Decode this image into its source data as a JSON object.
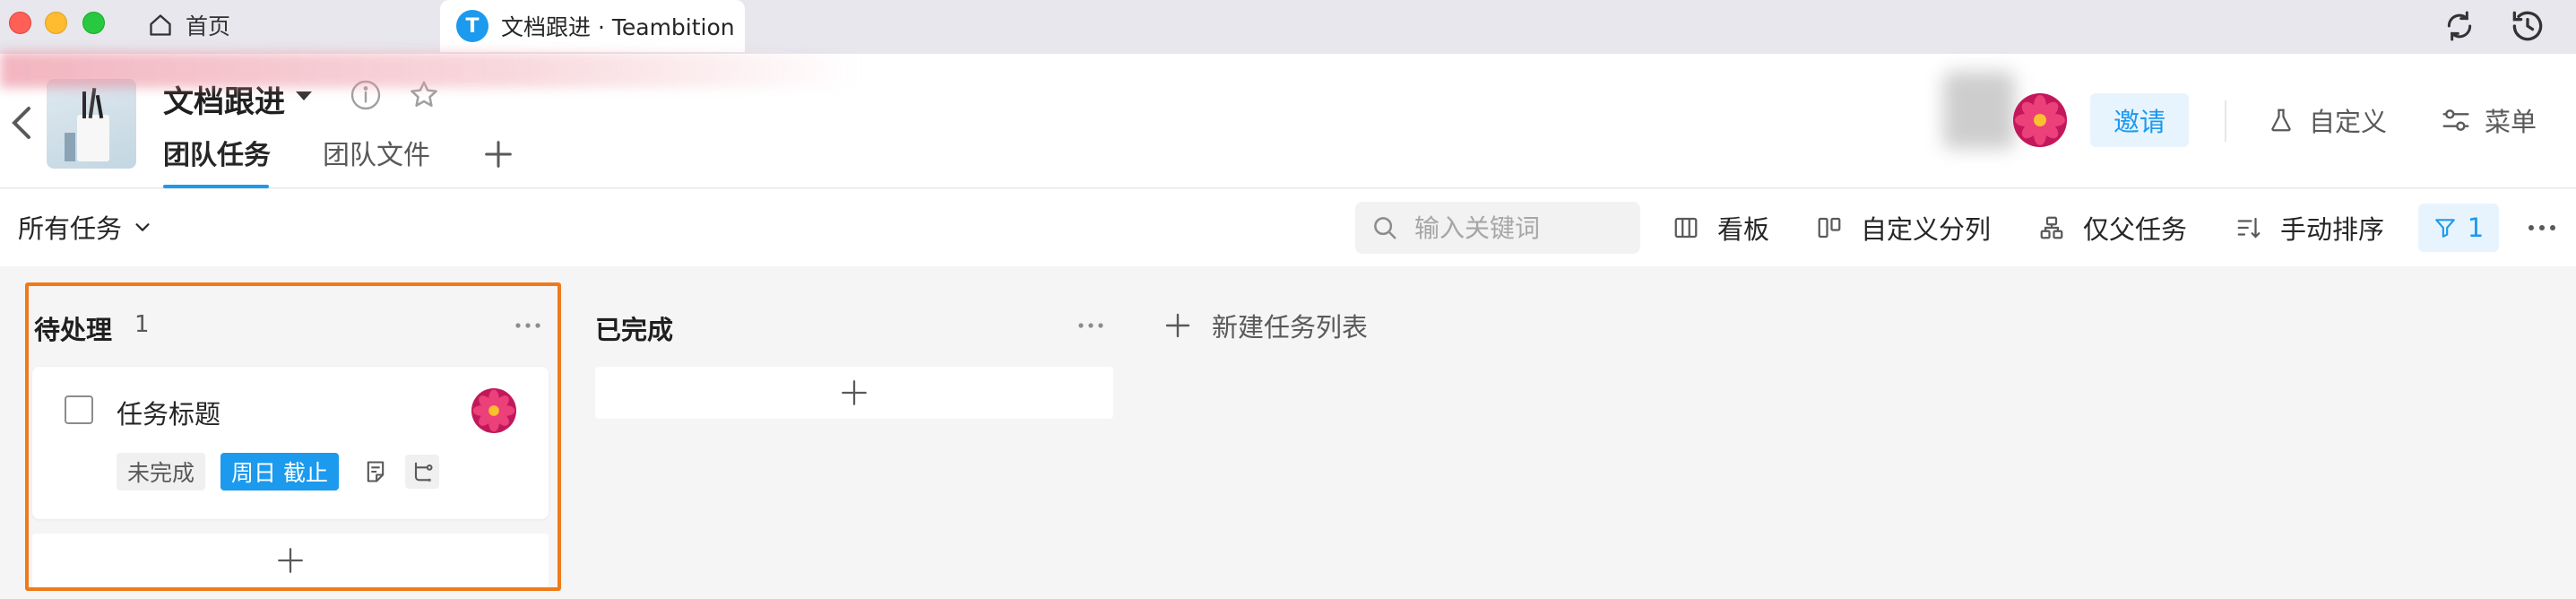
{
  "window": {
    "home_tab_label": "首页",
    "active_tab_label": "文档跟进 · Teambition",
    "active_tab_logo": "T"
  },
  "header": {
    "project_name": "文档跟进",
    "tabs": [
      {
        "label": "团队任务",
        "active": true
      },
      {
        "label": "团队文件",
        "active": false
      }
    ],
    "invite_label": "邀请",
    "customize_label": "自定义",
    "menu_label": "菜单"
  },
  "toolbar": {
    "all_tasks_label": "所有任务",
    "search_placeholder": "输入关键词",
    "kanban_label": "看板",
    "custom_split_label": "自定义分列",
    "parent_only_label": "仅父任务",
    "manual_sort_label": "手动排序",
    "filter_count": "1"
  },
  "board": {
    "columns": [
      {
        "title": "待处理",
        "count": "1",
        "tasks": [
          {
            "title": "任务标题",
            "status": "未完成",
            "due": "周日 截止"
          }
        ]
      },
      {
        "title": "已完成",
        "count": "",
        "tasks": []
      }
    ],
    "new_list_label": "新建任务列表"
  },
  "colors": {
    "accent": "#1b9aee",
    "highlight_border": "#f07a1a",
    "background": "#f5f5f5"
  },
  "icons": [
    "home-icon",
    "teambition-logo-icon",
    "sync-icon",
    "history-icon",
    "back-icon",
    "caret-down-icon",
    "info-icon",
    "star-icon",
    "plus-icon",
    "flask-icon",
    "sliders-icon",
    "chevron-down-icon",
    "search-icon",
    "columns-icon",
    "split-column-icon",
    "hierarchy-icon",
    "sort-icon",
    "filter-icon",
    "more-icon",
    "checkbox-icon",
    "note-icon",
    "subtask-icon"
  ]
}
